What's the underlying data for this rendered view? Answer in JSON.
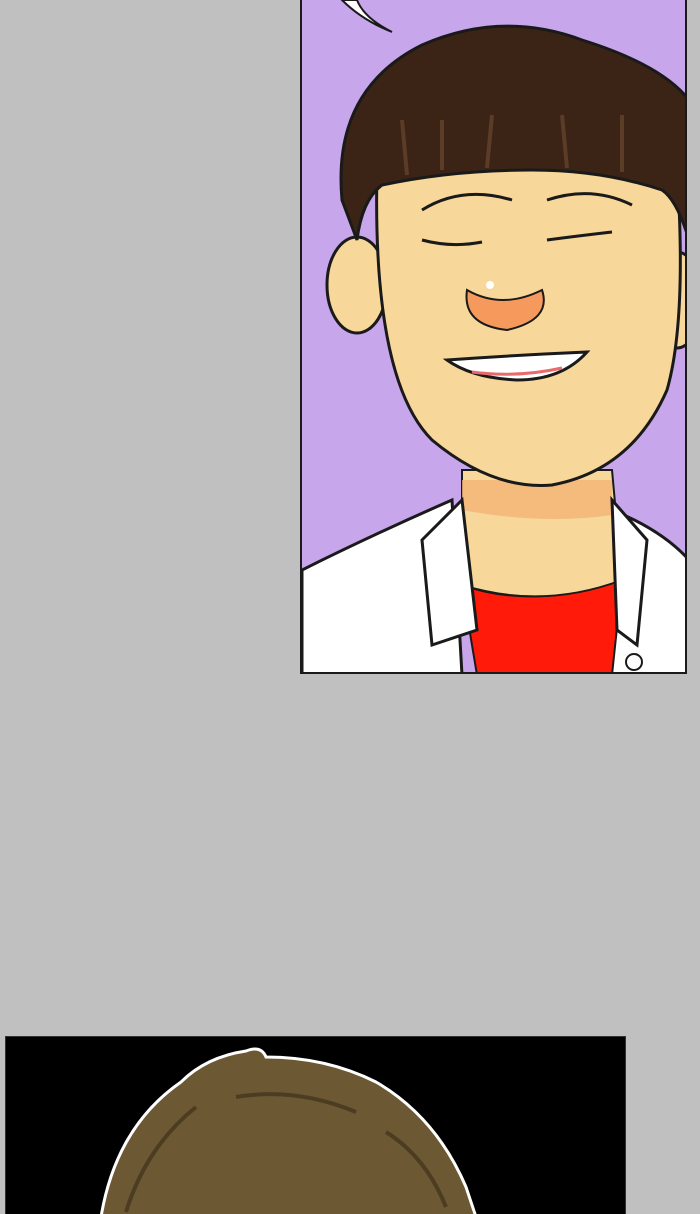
{
  "comic": {
    "panels": [
      {
        "id": "top",
        "scene": "smiling-boy-portrait"
      },
      {
        "id": "bottom",
        "scene": "hair-back-view"
      }
    ]
  },
  "colors": {
    "gutter": "#c0c0c0",
    "panel_bg_purple": "#c8a6ec",
    "panel_bg_black": "#000000",
    "skin": "#f7d79a",
    "hair_dark": "#3b2416",
    "hair_light": "#6d5834",
    "shirt": "#ffffff",
    "tshirt": "#ff1a0a"
  }
}
